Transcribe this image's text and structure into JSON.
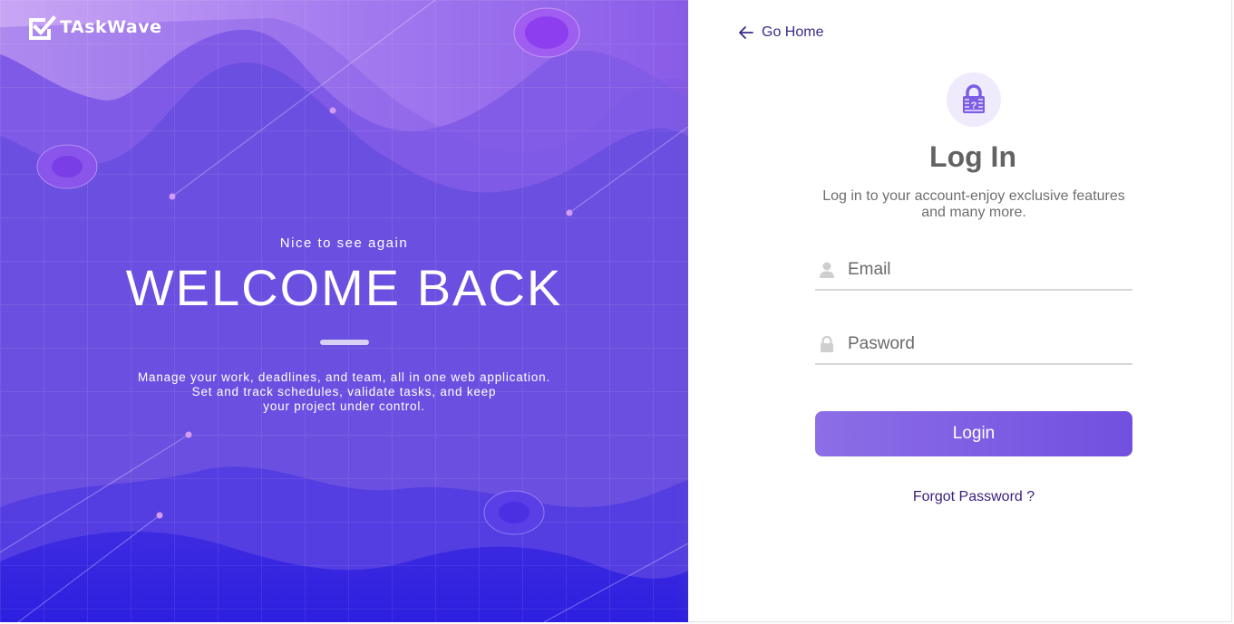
{
  "brand": {
    "name": "TAskWave",
    "logo_icon": "check-box-icon"
  },
  "hero": {
    "greeting": "Nice to see again",
    "title": "WELCOME BACK",
    "description": "Manage your work, deadlines, and team, all in one web application.\nSet and track schedules, validate tasks, and keep\nyour project under control."
  },
  "nav": {
    "go_home_label": "Go Home",
    "go_home_icon": "arrow-left-icon"
  },
  "login": {
    "badge_icon": "lock-question-icon",
    "title": "Log In",
    "subtitle": "Log in to your account-enjoy exclusive features and many more.",
    "email": {
      "placeholder": "Email",
      "value": "",
      "icon": "user-icon"
    },
    "password": {
      "placeholder": "Pasword",
      "value": "",
      "icon": "lock-icon"
    },
    "submit_label": "Login",
    "forgot_label": "Forgot Password ?"
  },
  "colors": {
    "hero_purple": "#6f4ee0",
    "hero_deep": "#3322dd",
    "accent": "#7150e0",
    "link": "#3a1f7a"
  }
}
